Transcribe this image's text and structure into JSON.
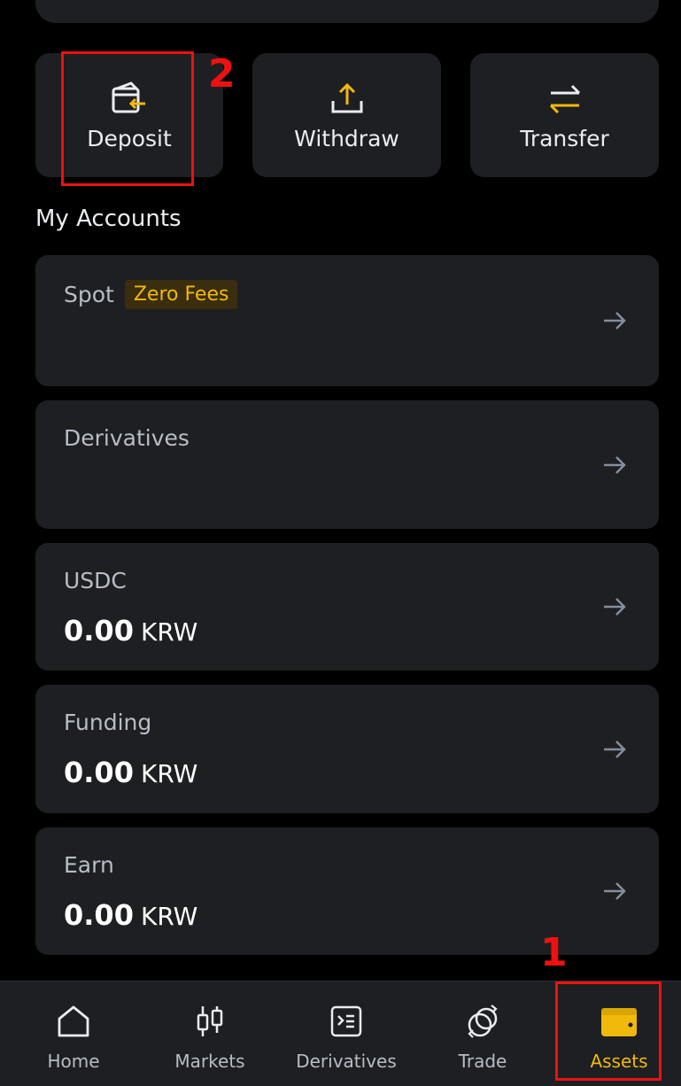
{
  "actions": {
    "deposit": "Deposit",
    "withdraw": "Withdraw",
    "transfer": "Transfer"
  },
  "section_title": "My Accounts",
  "accounts": [
    {
      "name": "Spot",
      "badge": "Zero Fees"
    },
    {
      "name": "Derivatives"
    },
    {
      "name": "USDC",
      "amount": "0.00",
      "currency": "KRW"
    },
    {
      "name": "Funding",
      "amount": "0.00",
      "currency": "KRW"
    },
    {
      "name": "Earn",
      "amount": "0.00",
      "currency": "KRW"
    }
  ],
  "tabs": [
    {
      "label": "Home",
      "icon": "home-icon"
    },
    {
      "label": "Markets",
      "icon": "candlestick-icon"
    },
    {
      "label": "Derivatives",
      "icon": "derivatives-icon"
    },
    {
      "label": "Trade",
      "icon": "trade-icon"
    },
    {
      "label": "Assets",
      "icon": "wallet-icon",
      "active": true
    }
  ],
  "annotations": {
    "step1": "1",
    "step2": "2"
  },
  "colors": {
    "accent": "#f0b90b",
    "card": "#1e1f22",
    "annotation": "#ee1111"
  }
}
